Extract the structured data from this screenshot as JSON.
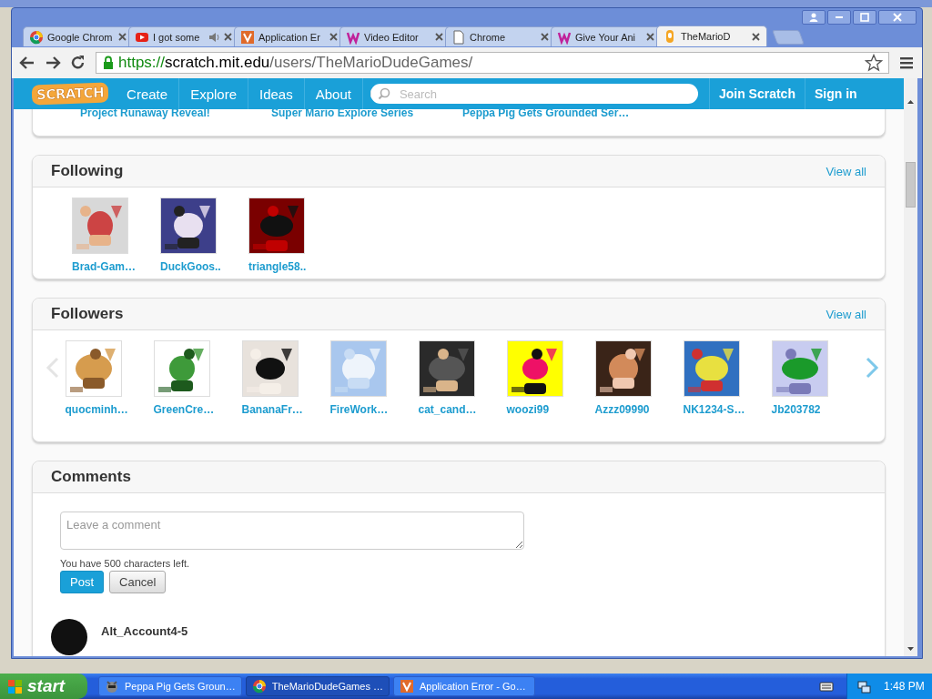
{
  "browser": {
    "tabs": [
      {
        "title": "Google Chrom",
        "selected": false,
        "audio": false
      },
      {
        "title": "I got some",
        "selected": false,
        "audio": true
      },
      {
        "title": "Application Er",
        "selected": false,
        "audio": false
      },
      {
        "title": "Video Editor",
        "selected": false,
        "audio": false
      },
      {
        "title": "Chrome",
        "selected": false,
        "audio": false
      },
      {
        "title": "Give Your Ani",
        "selected": false,
        "audio": false
      },
      {
        "title": "TheMarioD",
        "selected": true,
        "audio": false
      }
    ],
    "url": {
      "scheme": "https://",
      "host": "scratch.mit.edu",
      "path": "/users/TheMarioDudeGames/"
    }
  },
  "nav": {
    "logo": "SCRATCH",
    "links": [
      "Create",
      "Explore",
      "Ideas",
      "About"
    ],
    "search": {
      "placeholder": "Search"
    },
    "actions": [
      "Join Scratch",
      "Sign in"
    ]
  },
  "projects_row": [
    "Project Runaway Reveal!",
    "Super Mario Explore Series",
    "Peppa Pig Gets Grounded Ser…"
  ],
  "following": {
    "title": "Following",
    "view_all": "View all",
    "users": [
      "Brad-Gam…",
      "DuckGoos..",
      "triangle58.."
    ]
  },
  "followers": {
    "title": "Followers",
    "view_all": "View all",
    "prev_disabled": true,
    "next_disabled": false,
    "users": [
      "quocminh…",
      "GreenCre…",
      "BananaFr…",
      "FireWork…",
      "cat_cand…",
      "woozi99",
      "Azzz09990",
      "NK1234-S…",
      "Jb203782"
    ]
  },
  "comments": {
    "title": "Comments",
    "input": {
      "placeholder": "Leave a comment"
    },
    "remaining": "You have 500 characters left.",
    "buttons": [
      "Post",
      "Cancel"
    ],
    "entries": [
      {
        "author": "Alt_Account4-5"
      }
    ]
  },
  "taskbar": {
    "start": "start",
    "tasks": [
      {
        "title": "Peppa Pig Gets Groun…",
        "selected": false
      },
      {
        "title": "TheMarioDudeGames …",
        "selected": true
      },
      {
        "title": "Application Error - Go…",
        "selected": false
      }
    ],
    "clock": "1:48 PM"
  }
}
